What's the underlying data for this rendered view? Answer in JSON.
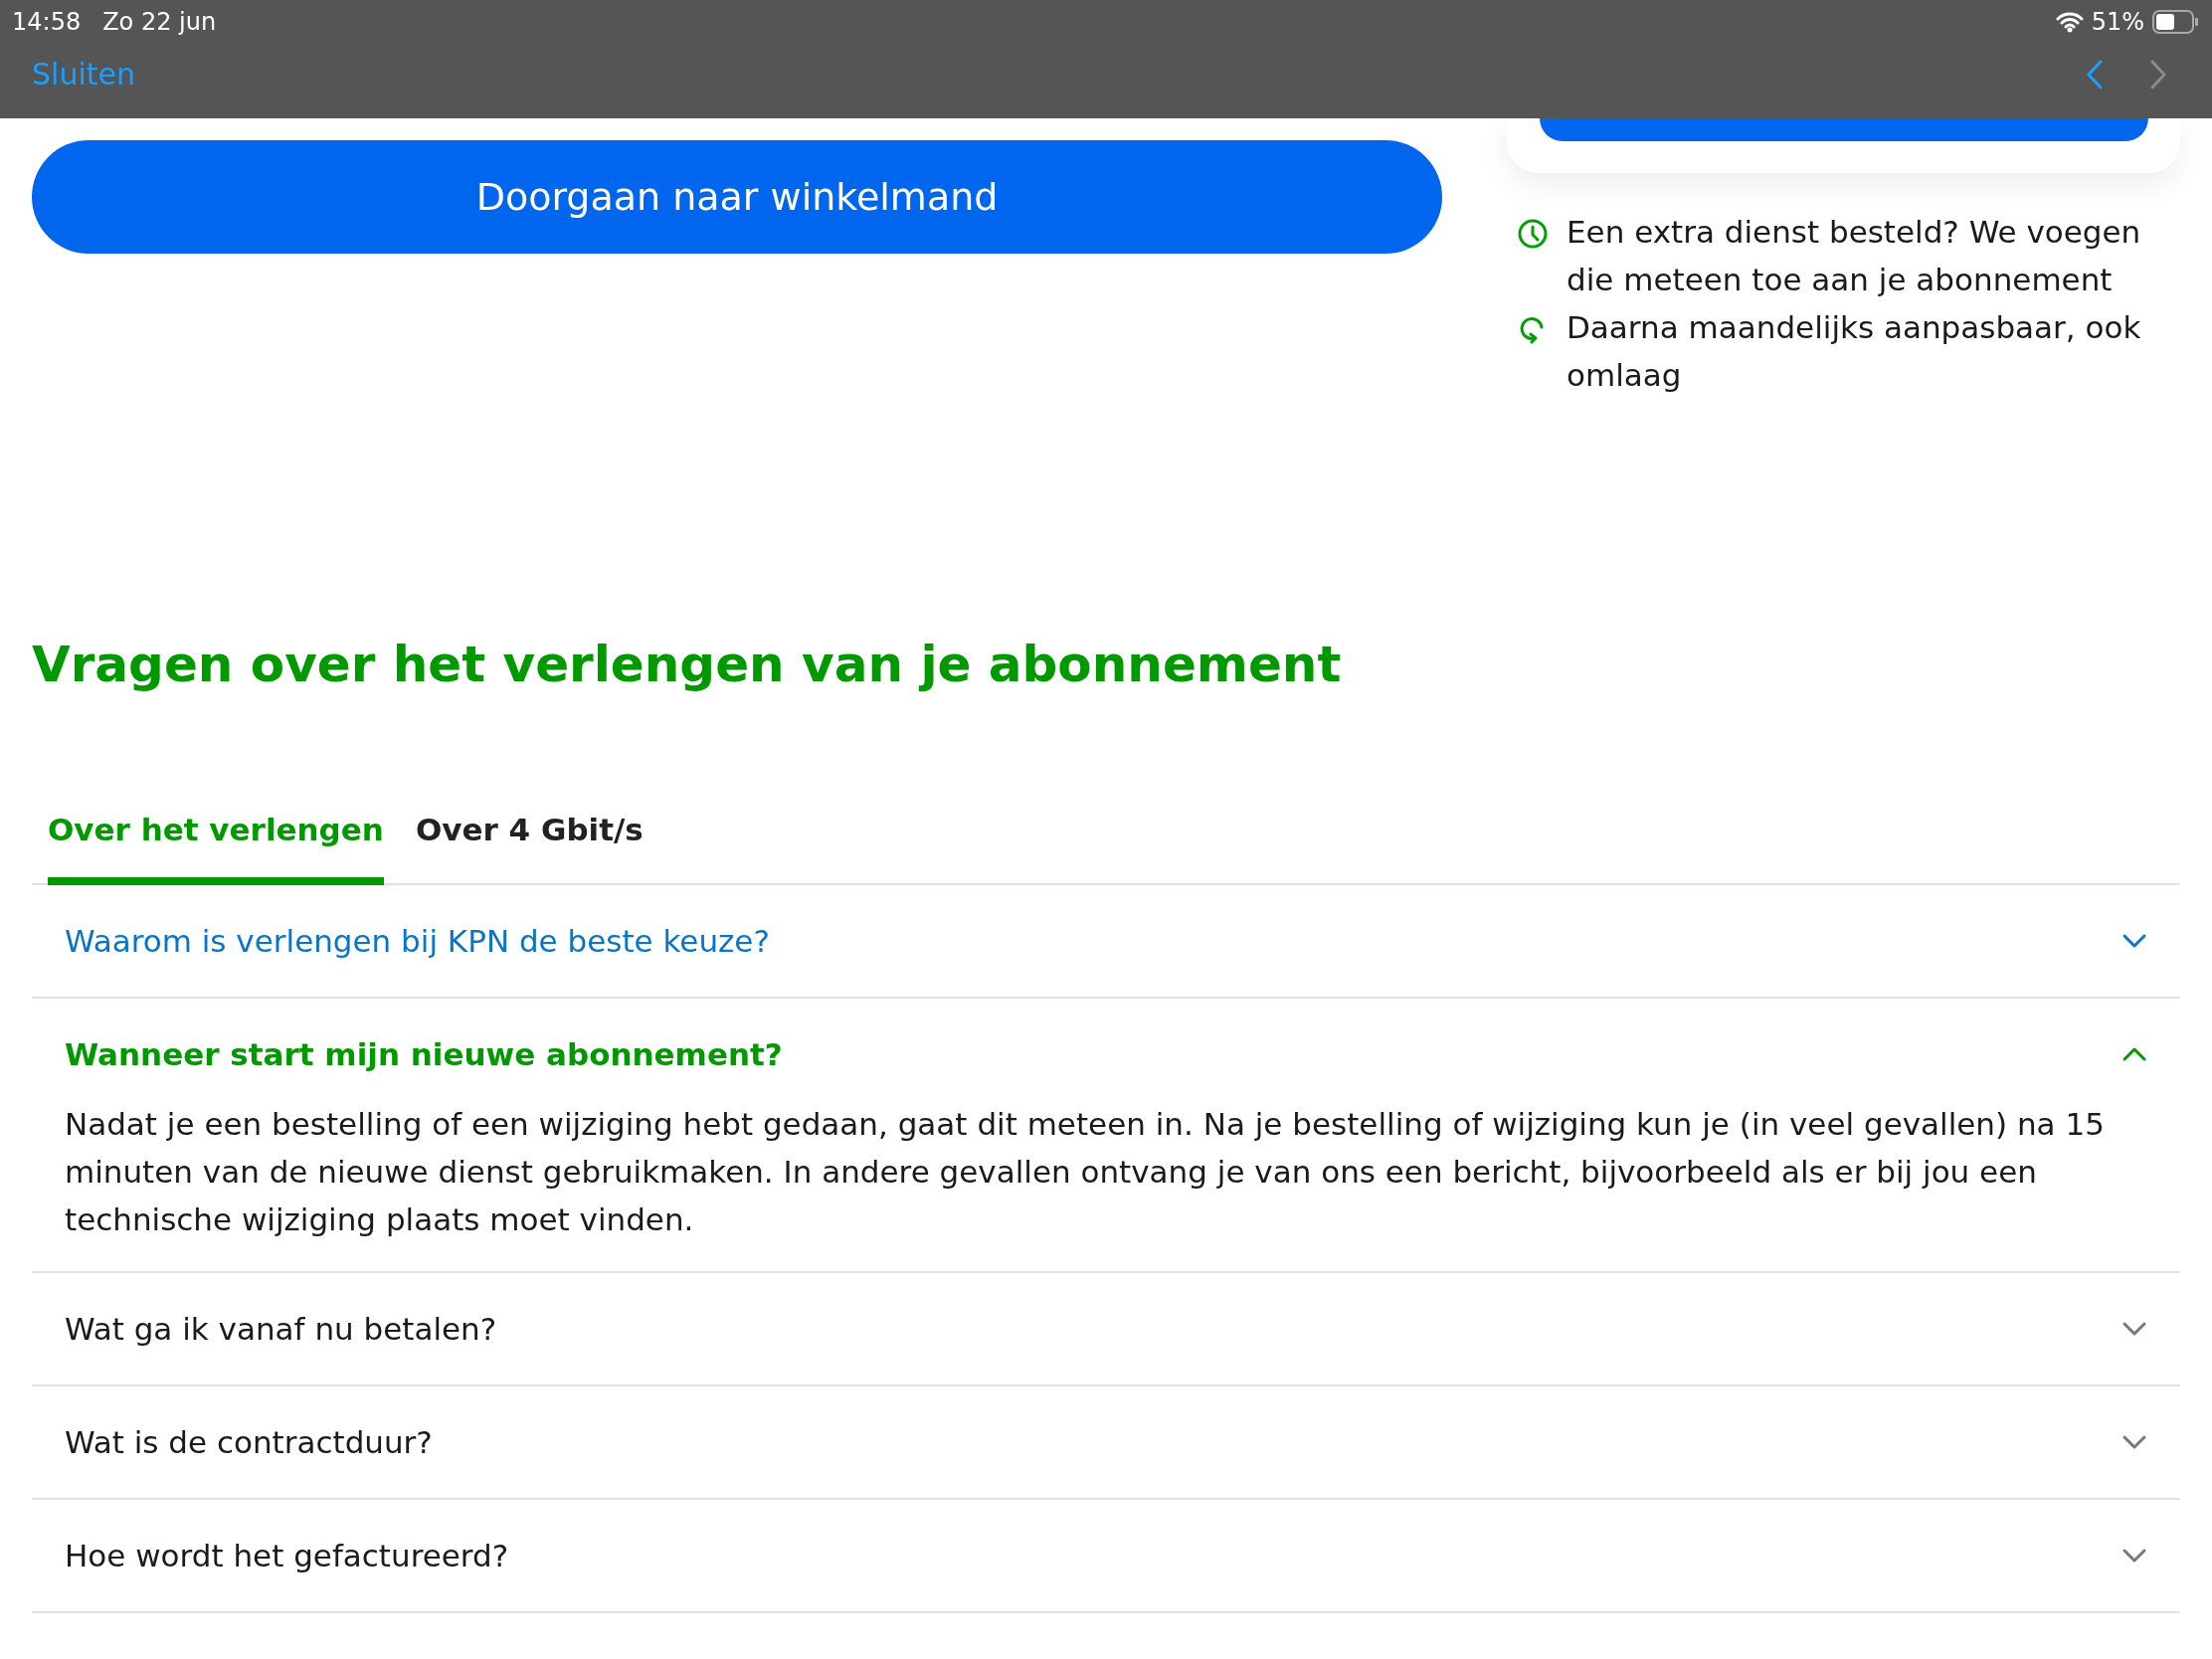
{
  "status_bar": {
    "time": "14:58",
    "date": "Zo 22 jun",
    "battery": "51%"
  },
  "browser_bar": {
    "close_label": "Sluiten",
    "back_enabled": true,
    "forward_enabled": false
  },
  "cart_button": {
    "label": "Doorgaan naar winkelmand"
  },
  "benefits": [
    {
      "kind": "clock",
      "text": "Een extra dienst besteld? We voegen die meteen toe aan je abonnement"
    },
    {
      "kind": "refresh",
      "text": "Daarna maandelijks aanpasbaar, ook omlaag"
    }
  ],
  "faq_title": "Vragen over het verlengen van je abonnement",
  "tabs": [
    {
      "label": "Over het verlengen",
      "selected": true
    },
    {
      "label": "Over 4 Gbit/s",
      "selected": false
    }
  ],
  "faq": [
    {
      "question": "Waarom is verlengen bij KPN de beste keuze?",
      "expanded": false,
      "highlighted": true
    },
    {
      "question": "Wanneer start mijn nieuwe abonnement?",
      "expanded": true,
      "highlighted": false,
      "answer": "Nadat je een bestelling of een wijziging hebt gedaan, gaat dit meteen in. Na je bestelling of wijziging kun je (in veel gevallen) na 15 minuten van de nieuwe dienst gebruikmaken. In andere gevallen ontvang je van ons een bericht, bijvoorbeeld als er bij jou een technische wijziging plaats moet vinden."
    },
    {
      "question": "Wat ga ik vanaf nu betalen?",
      "expanded": false,
      "highlighted": false
    },
    {
      "question": "Wat is de contractduur?",
      "expanded": false,
      "highlighted": false
    },
    {
      "question": "Hoe wordt het gefactureerd?",
      "expanded": false,
      "highlighted": false
    }
  ]
}
